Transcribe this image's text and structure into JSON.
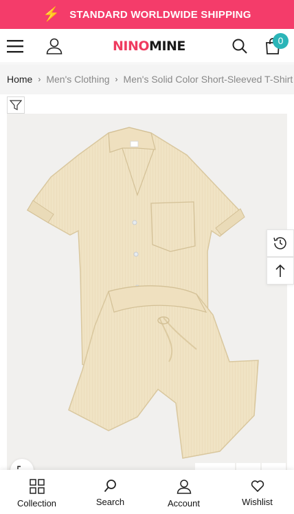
{
  "announcement": {
    "text": "STANDARD WORLDWIDE SHIPPING",
    "icon": "lightning-icon",
    "bg": "#f43c6a"
  },
  "header": {
    "logo_part1": "NINO",
    "logo_part2": "MINE",
    "cart_count": "0",
    "icons": [
      "menu-icon",
      "account-icon",
      "search-icon",
      "cart-icon"
    ]
  },
  "breadcrumb": {
    "items": [
      "Home",
      "Men's Clothing",
      "Men's Solid Color Short-Sleeved T-Shirt Sh"
    ]
  },
  "product": {
    "image_alt": "Men's solid color short-sleeved shirt and shorts set",
    "color": "#f0e3c4"
  },
  "side_tools": [
    "recently-viewed-icon",
    "back-to-top-icon"
  ],
  "bottom_nav": {
    "items": [
      {
        "label": "Collection",
        "icon": "grid-icon"
      },
      {
        "label": "Search",
        "icon": "search-icon"
      },
      {
        "label": "Account",
        "icon": "account-icon"
      },
      {
        "label": "Wishlist",
        "icon": "heart-icon"
      }
    ]
  }
}
